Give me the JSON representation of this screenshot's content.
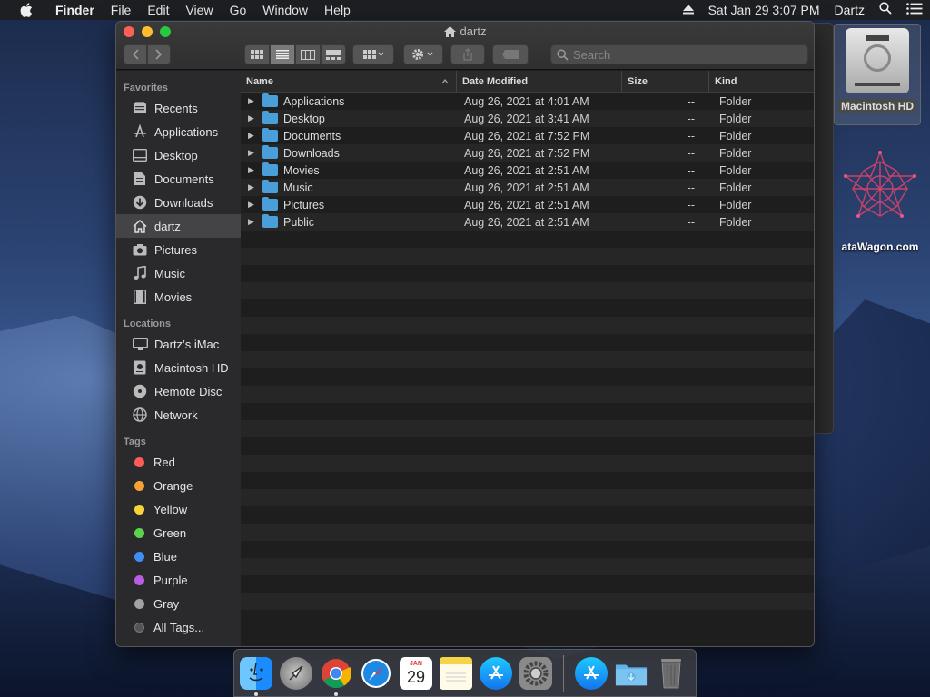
{
  "menubar": {
    "app": "Finder",
    "items": [
      "File",
      "Edit",
      "View",
      "Go",
      "Window",
      "Help"
    ],
    "datetime": "Sat Jan 29  3:07 PM",
    "user": "Dartz"
  },
  "desktop": {
    "hd_label": "Macintosh HD",
    "datawagon_label": "ataWagon.com"
  },
  "window": {
    "title": "dartz",
    "search_placeholder": "Search",
    "columns": {
      "name": "Name",
      "date": "Date Modified",
      "size": "Size",
      "kind": "Kind"
    },
    "files": [
      {
        "name": "Applications",
        "date": "Aug 26, 2021 at 4:01 AM",
        "size": "--",
        "kind": "Folder"
      },
      {
        "name": "Desktop",
        "date": "Aug 26, 2021 at 3:41 AM",
        "size": "--",
        "kind": "Folder"
      },
      {
        "name": "Documents",
        "date": "Aug 26, 2021 at 7:52 PM",
        "size": "--",
        "kind": "Folder"
      },
      {
        "name": "Downloads",
        "date": "Aug 26, 2021 at 7:52 PM",
        "size": "--",
        "kind": "Folder"
      },
      {
        "name": "Movies",
        "date": "Aug 26, 2021 at 2:51 AM",
        "size": "--",
        "kind": "Folder"
      },
      {
        "name": "Music",
        "date": "Aug 26, 2021 at 2:51 AM",
        "size": "--",
        "kind": "Folder"
      },
      {
        "name": "Pictures",
        "date": "Aug 26, 2021 at 2:51 AM",
        "size": "--",
        "kind": "Folder"
      },
      {
        "name": "Public",
        "date": "Aug 26, 2021 at 2:51 AM",
        "size": "--",
        "kind": "Folder"
      }
    ]
  },
  "sidebar": {
    "favorites_header": "Favorites",
    "favorites": [
      "Recents",
      "Applications",
      "Desktop",
      "Documents",
      "Downloads",
      "dartz",
      "Pictures",
      "Music",
      "Movies"
    ],
    "locations_header": "Locations",
    "locations": [
      "Dartz’s iMac",
      "Macintosh HD",
      "Remote Disc",
      "Network"
    ],
    "tags_header": "Tags",
    "tags": [
      {
        "label": "Red",
        "color": "#fc5b57"
      },
      {
        "label": "Orange",
        "color": "#f6a236"
      },
      {
        "label": "Yellow",
        "color": "#f7d43a"
      },
      {
        "label": "Green",
        "color": "#5ed04f"
      },
      {
        "label": "Blue",
        "color": "#3d8ff6"
      },
      {
        "label": "Purple",
        "color": "#b95ee0"
      },
      {
        "label": "Gray",
        "color": "#a2a2a6"
      }
    ],
    "all_tags": "All Tags..."
  },
  "dock": {
    "calendar_month": "JAN",
    "calendar_day": "29"
  }
}
